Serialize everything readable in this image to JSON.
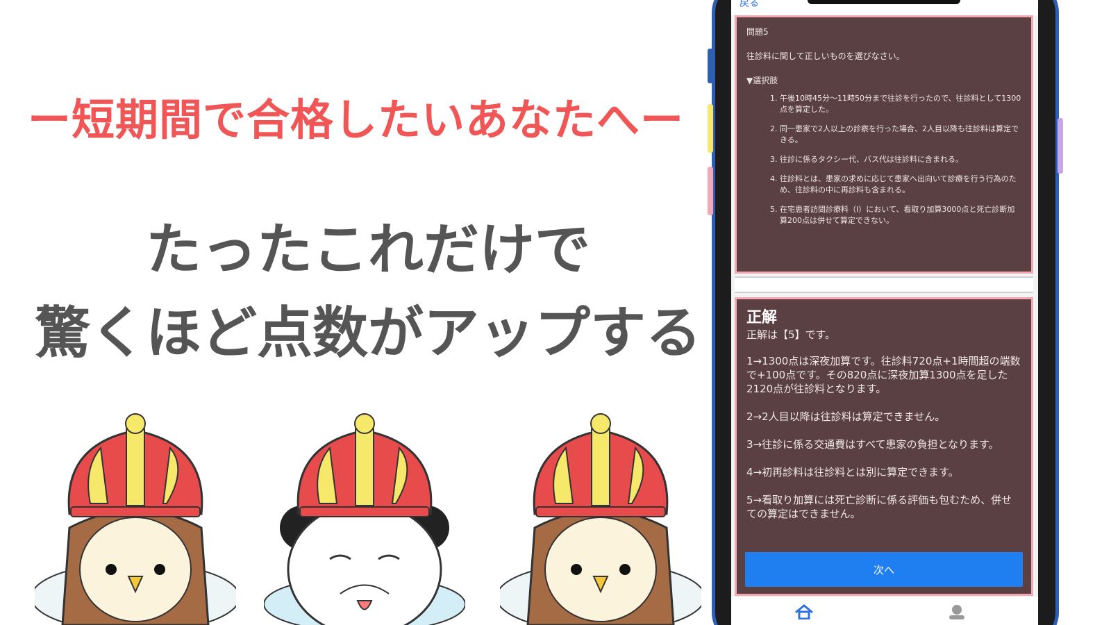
{
  "promo": {
    "tagline": "ー短期間で合格したいあなたへー",
    "headline_line1": "たったこれだけで",
    "headline_line2": "驚くほど点数がアップする"
  },
  "phone": {
    "back_label": "戻る",
    "question": {
      "header": "問題5",
      "prompt": "往診料に関して正しいものを選びなさい。",
      "options_title": "▼選択肢",
      "options": [
        "午後10時45分〜11時50分まで往診を行ったので、往診料として1300点を算定した。",
        "同一患家で2人以上の診察を行った場合、2人目以降も往診料は算定できる。",
        "往診に係るタクシー代、バス代は往診料に含まれる。",
        "往診料とは、患家の求めに応じて患家へ出向いて診療を行う行為のため、往診料の中に再診料も含まれる。",
        "在宅患者訪問診療料（I）において、看取り加算3000点と死亡診断加算200点は併せて算定できない。"
      ]
    },
    "answer": {
      "title": "正解",
      "correct": "正解は【5】です。",
      "explanations": [
        "1→1300点は深夜加算です。往診料720点+1時間超の端数で+100点です。その820点に深夜加算1300点を足した2120点が往診料となります。",
        "2→2人目以降は往診料は算定できません。",
        "3→往診に係る交通費はすべて患家の負担となります。",
        "4→初再診料は往診料とは別に算定できます。",
        "5→看取り加算には死亡診断に係る評価も包むため、併せての算定はできません。"
      ],
      "next_label": "次へ"
    }
  },
  "colors": {
    "tagline": "#f05656",
    "headline": "#555555",
    "panel_bg": "#5a4042",
    "panel_border": "#f2a9b3",
    "next_button": "#1f7ff0",
    "phone_frame": "#2e5fb5"
  },
  "characters": [
    "owl-king",
    "panda-king",
    "owl-king"
  ]
}
